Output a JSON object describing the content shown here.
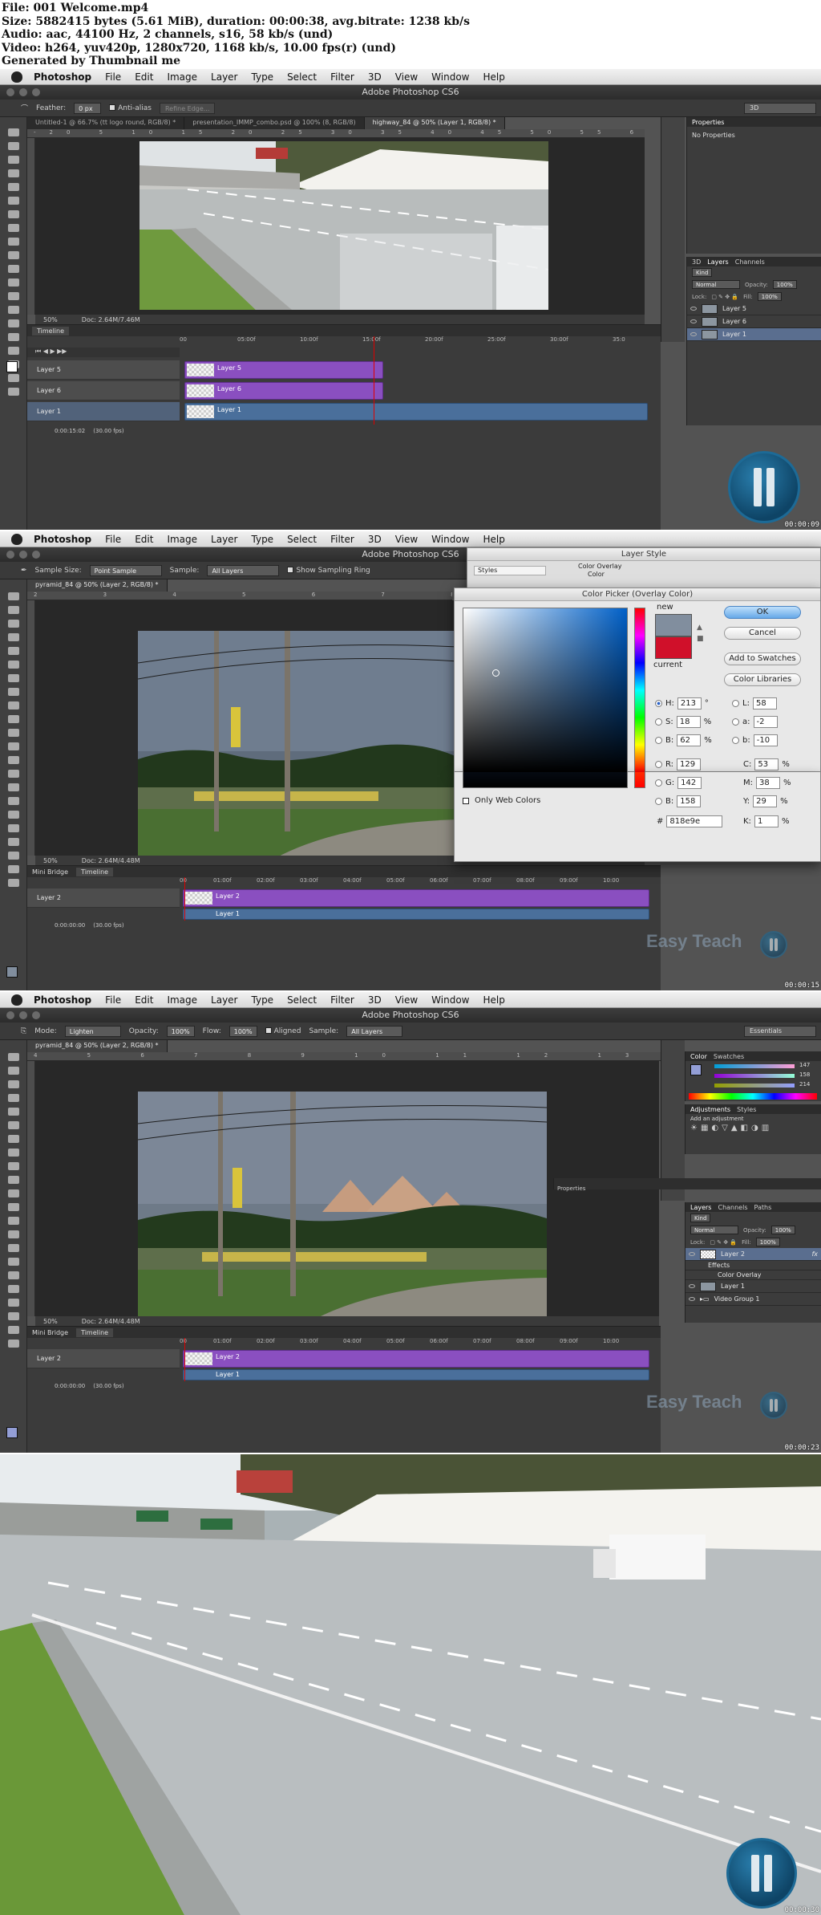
{
  "info": {
    "lines": [
      "File: 001 Welcome.mp4",
      "Size: 5882415 bytes (5.61 MiB), duration: 00:00:38, avg.bitrate: 1238 kb/s",
      "Audio: aac, 44100 Hz, 2 channels, s16, 58 kb/s (und)",
      "Video: h264, yuv420p, 1280x720, 1168 kb/s, 10.00 fps(r) (und)",
      "Generated by Thumbnail me"
    ]
  },
  "menu": [
    "Photoshop",
    "File",
    "Edit",
    "Image",
    "Layer",
    "Type",
    "Select",
    "Filter",
    "3D",
    "View",
    "Window",
    "Help"
  ],
  "window_title": "Adobe Photoshop CS6",
  "frames": [
    {
      "timestamp": "00:00:09",
      "options": {
        "feather_label": "Feather:",
        "feather_value": "0 px",
        "antialias_label": "Anti-alias",
        "refine_label": "Refine Edge...",
        "workspace": "3D"
      },
      "tabs": [
        "Untitled-1 @ 66.7% (tt logo round, RGB/8) *",
        "presentation_IMMP_combo.psd @ 100% (8, RGB/8)",
        "highway_84 @ 50% (Layer 1, RGB/8) *"
      ],
      "ruler_marks": "-20 5 10 15 20 25 30 35 40 45 50 55 60 65 70 75 80 85 90 95 100 105 110 115 120",
      "status": {
        "zoom": "50%",
        "doc": "Doc: 2.64M/7.46M"
      },
      "timeline": {
        "tab": "Timeline",
        "ticks": [
          "00",
          "05:00f",
          "10:00f",
          "15:00f",
          "20:00f",
          "25:00f",
          "30:00f",
          "35:0"
        ],
        "time": "0:00:15:02",
        "fps": "(30.00 fps)"
      },
      "tracks": [
        {
          "name": "Layer 5",
          "clip": "Layer 5"
        },
        {
          "name": "Layer 6",
          "clip": "Layer 6"
        },
        {
          "name": "Layer 1",
          "clip": "Layer 1"
        }
      ],
      "properties": {
        "title": "Properties",
        "content": "No Properties"
      },
      "layers_panel": {
        "tabs": [
          "3D",
          "Layers",
          "Channels"
        ],
        "kind": "Kind",
        "blend": "Normal",
        "opacity_label": "Opacity:",
        "opacity": "100%",
        "lock_label": "Lock:",
        "fill_label": "Fill:",
        "fill": "100%",
        "layers": [
          "Layer 5",
          "Layer 6",
          "Layer 1"
        ]
      }
    },
    {
      "timestamp": "00:00:15",
      "options": {
        "sample_size_label": "Sample Size:",
        "sample_size": "Point Sample",
        "sample_label": "Sample:",
        "sample": "All Layers",
        "ring_label": "Show Sampling Ring"
      },
      "tabs": [
        "pyramid_84 @ 50% (Layer 2, RGB/8) *"
      ],
      "ruler_marks": "2 3 4 5 6 7 8 9 10 11 12 13",
      "status": {
        "zoom": "50%",
        "doc": "Doc: 2.64M/4.48M"
      },
      "timeline": {
        "tabs": [
          "Mini Bridge",
          "Timeline"
        ],
        "ticks": [
          "00",
          "01:00f",
          "02:00f",
          "03:00f",
          "04:00f",
          "05:00f",
          "06:00f",
          "07:00f",
          "08:00f",
          "09:00f",
          "10:00"
        ],
        "time": "0:00:00:00",
        "fps": "(30.00 fps)"
      },
      "tracks": [
        {
          "name": "Layer 2",
          "clip": "Layer 2"
        },
        {
          "name": "",
          "clip": "Layer 1"
        }
      ],
      "layer_style": {
        "title": "Layer Style",
        "styles_label": "Styles",
        "overlay_group": "Color Overlay",
        "overlay_sub": "Color"
      },
      "color_picker": {
        "title": "Color Picker (Overlay Color)",
        "new_label": "new",
        "current_label": "current",
        "ok": "OK",
        "cancel": "Cancel",
        "add_swatches": "Add to Swatches",
        "libraries": "Color Libraries",
        "only_web": "Only Web Colors",
        "H": "213",
        "S": "18",
        "B": "62",
        "R": "129",
        "G": "142",
        "Bv": "158",
        "L": "58",
        "a": "-2",
        "b": "-10",
        "C": "53",
        "M": "38",
        "Y": "29",
        "K": "1",
        "hex": "818e9e",
        "deg": "°",
        "pct": "%",
        "new_color": "#818e9e",
        "current_color": "#d0102a"
      },
      "watermark": "Easy Teach"
    },
    {
      "timestamp": "00:00:23",
      "options": {
        "mode_label": "Mode:",
        "mode": "Lighten",
        "opacity_label": "Opacity:",
        "opacity": "100%",
        "flow_label": "Flow:",
        "flow": "100%",
        "aligned_label": "Aligned",
        "sample_label": "Sample:",
        "sample": "All Layers",
        "workspace": "Essentials"
      },
      "tabs": [
        "pyramid_84 @ 50% (Layer 2, RGB/8) *"
      ],
      "ruler_marks": "4 5 6 7 8 9 10 11 12 13 14 15 16 17 18 19 20 21",
      "status": {
        "zoom": "50%",
        "doc": "Doc: 2.64M/4.48M"
      },
      "timeline": {
        "tabs": [
          "Mini Bridge",
          "Timeline"
        ],
        "ticks": [
          "00",
          "01:00f",
          "02:00f",
          "03:00f",
          "04:00f",
          "05:00f",
          "06:00f",
          "07:00f",
          "08:00f",
          "09:00f",
          "10:00"
        ],
        "time": "0:00:00:00",
        "fps": "(30.00 fps)"
      },
      "tracks": [
        {
          "name": "Layer 2",
          "clip": "Layer 2"
        },
        {
          "name": "",
          "clip": "Layer 1"
        }
      ],
      "color_panel": {
        "tabs": [
          "Color",
          "Swatches"
        ],
        "r": "147",
        "g": "158",
        "b": "214"
      },
      "adjustments_panel": {
        "tabs": [
          "Adjustments",
          "Styles"
        ],
        "hint": "Add an adjustment"
      },
      "properties_label": "Properties",
      "layers_panel": {
        "tabs": [
          "Layers",
          "Channels",
          "Paths"
        ],
        "kind": "Kind",
        "blend": "Normal",
        "opacity_label": "Opacity:",
        "opacity": "100%",
        "lock_label": "Lock:",
        "fill_label": "Fill:",
        "fill": "100%",
        "layers": [
          "Layer 2",
          "Effects",
          "Color Overlay",
          "Layer 1",
          "Video Group 1"
        ],
        "fx": "fx"
      },
      "watermark": "Easy Teach"
    },
    {
      "timestamp": "00:00:30"
    }
  ]
}
